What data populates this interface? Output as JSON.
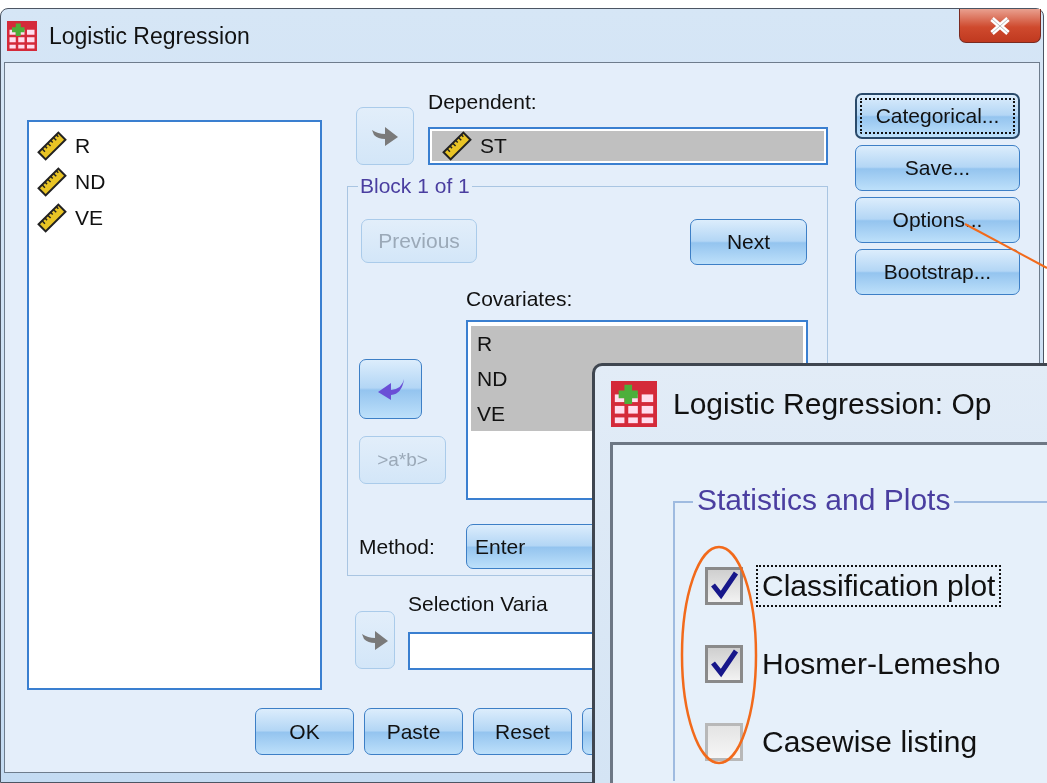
{
  "window": {
    "title": "Logistic Regression"
  },
  "variables": [
    "R",
    "ND",
    "VE"
  ],
  "dependent": {
    "label": "Dependent:",
    "arrow": {
      "kind": "right",
      "disabled": true
    },
    "value": "ST"
  },
  "block": {
    "title": "Block 1 of 1",
    "buttons": [
      {
        "label": "Previous",
        "disabled": true
      },
      {
        "label": "Next",
        "disabled": false
      }
    ],
    "covariates": {
      "label": "Covariates:",
      "arrow": {
        "kind": "left",
        "disabled": false
      },
      "items": [
        "R",
        "ND",
        "VE"
      ]
    },
    "interaction_button": {
      "label": ">a*b>",
      "disabled": true
    },
    "method": {
      "label": "Method:",
      "value": "Enter"
    }
  },
  "selection_variable": {
    "label": "Selection Varia",
    "arrow": {
      "kind": "right",
      "disabled": true
    }
  },
  "side_buttons": [
    {
      "label": "Categorical...",
      "focused": true
    },
    {
      "label": "Save...",
      "focused": false
    },
    {
      "label": "Options...",
      "focused": false
    },
    {
      "label": "Bootstrap...",
      "focused": false
    }
  ],
  "bottom_buttons": [
    {
      "kind": "button",
      "label": "OK"
    },
    {
      "kind": "button",
      "label": "Paste"
    },
    {
      "kind": "button",
      "label": "Reset"
    },
    {
      "kind": "cut"
    }
  ],
  "options_dialog": {
    "title": "Logistic Regression: Op",
    "group": "Statistics and Plots",
    "checkboxes": [
      {
        "label": "Classification plot",
        "checked": true,
        "focused": true
      },
      {
        "label": "Hosmer-Lemesho",
        "checked": true,
        "focused": false
      },
      {
        "label": "Casewise listing",
        "checked": false,
        "focused": false
      }
    ]
  },
  "annotations": {
    "leader_line": true,
    "highlight_ellipse": true
  }
}
